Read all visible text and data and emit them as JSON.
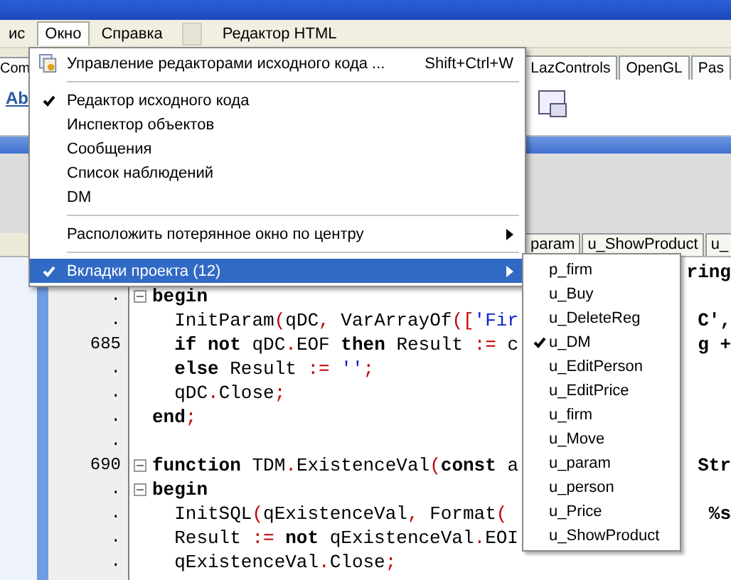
{
  "menubar": [
    {
      "label": "ис",
      "selected": false
    },
    {
      "label": "Окно",
      "selected": true
    },
    {
      "label": "Справка",
      "selected": false
    },
    {
      "kind": "blank",
      "selected": false
    },
    {
      "label": "Редактор HTML",
      "selected": false
    }
  ],
  "palette_tabs": [
    {
      "label": "Com"
    },
    {
      "label": "LazControls"
    },
    {
      "label": "OpenGL"
    },
    {
      "label": "Pas"
    }
  ],
  "toolbar_text": "Ab",
  "editor_tabs": [
    {
      "label": "param"
    },
    {
      "label": "u_ShowProduct"
    },
    {
      "label": "u_"
    }
  ],
  "code": [
    {
      "tail": "ring"
    },
    {
      "num": ".",
      "fold": true,
      "segs": [
        {
          "t": "begin",
          "kind": "kw"
        }
      ]
    },
    {
      "num": ".",
      "fold": false,
      "segs": [
        {
          "t": "  InitParam",
          "kind": "plain"
        },
        {
          "t": "(",
          "kind": "sym"
        },
        {
          "t": "qDC",
          "kind": "plain"
        },
        {
          "t": ",",
          "kind": "sym"
        },
        {
          "t": " VarArrayOf",
          "kind": "plain"
        },
        {
          "t": "([",
          "kind": "sym"
        },
        {
          "t": "'Fir",
          "kind": "str"
        }
      ],
      "tail": "C',"
    },
    {
      "num": "685",
      "fold": false,
      "segs": [
        {
          "t": "  if not",
          "kind": "kw"
        },
        {
          "t": " qDC",
          "kind": "plain"
        },
        {
          "t": ".",
          "kind": "sym"
        },
        {
          "t": "EOF ",
          "kind": "plain"
        },
        {
          "t": "then",
          "kind": "kw"
        },
        {
          "t": " Result ",
          "kind": "plain"
        },
        {
          "t": ":=",
          "kind": "sym"
        },
        {
          "t": " c",
          "kind": "plain"
        }
      ],
      "tail": "g +"
    },
    {
      "num": ".",
      "fold": false,
      "segs": [
        {
          "t": "  else",
          "kind": "kw"
        },
        {
          "t": " Result ",
          "kind": "plain"
        },
        {
          "t": ":=",
          "kind": "sym"
        },
        {
          "t": " ''",
          "kind": "str"
        },
        {
          "t": ";",
          "kind": "sym"
        }
      ]
    },
    {
      "num": ".",
      "fold": false,
      "segs": [
        {
          "t": "  qDC",
          "kind": "plain"
        },
        {
          "t": ".",
          "kind": "sym"
        },
        {
          "t": "Close",
          "kind": "plain"
        },
        {
          "t": ";",
          "kind": "sym"
        }
      ]
    },
    {
      "num": ".",
      "fold": false,
      "segs": [
        {
          "t": "end",
          "kind": "kw"
        },
        {
          "t": ";",
          "kind": "sym"
        }
      ]
    },
    {
      "num": ".",
      "fold": false
    },
    {
      "num": "690",
      "fold": true,
      "segs": [
        {
          "t": "function",
          "kind": "kw"
        },
        {
          "t": " TDM",
          "kind": "plain"
        },
        {
          "t": ".",
          "kind": "sym"
        },
        {
          "t": "ExistenceVal",
          "kind": "plain"
        },
        {
          "t": "(",
          "kind": "sym"
        },
        {
          "t": "const",
          "kind": "kw"
        },
        {
          "t": " a",
          "kind": "plain"
        }
      ],
      "tail": "Str"
    },
    {
      "num": ".",
      "fold": true,
      "segs": [
        {
          "t": "begin",
          "kind": "kw"
        }
      ]
    },
    {
      "num": ".",
      "fold": false,
      "segs": [
        {
          "t": "  InitSQL",
          "kind": "plain"
        },
        {
          "t": "(",
          "kind": "sym"
        },
        {
          "t": "qExistenceVal",
          "kind": "plain"
        },
        {
          "t": ",",
          "kind": "sym"
        },
        {
          "t": " Format",
          "kind": "plain"
        },
        {
          "t": "(",
          "kind": "sym"
        }
      ],
      "tail": "%s"
    },
    {
      "num": ".",
      "fold": false,
      "segs": [
        {
          "t": "  Result ",
          "kind": "plain"
        },
        {
          "t": ":=",
          "kind": "sym"
        },
        {
          "t": " not",
          "kind": "kw"
        },
        {
          "t": " qExistenceVal",
          "kind": "plain"
        },
        {
          "t": ".",
          "kind": "sym"
        },
        {
          "t": "EOI",
          "kind": "plain"
        }
      ]
    },
    {
      "num": ".",
      "fold": false,
      "segs": [
        {
          "t": "  qExistenceVal",
          "kind": "plain"
        },
        {
          "t": ".",
          "kind": "sym"
        },
        {
          "t": "Close",
          "kind": "plain"
        },
        {
          "t": ";",
          "kind": "sym"
        }
      ]
    }
  ],
  "window_menu": [
    {
      "kind": "icon",
      "label": "Управление редакторами исходного кода ...",
      "shortcut": "Shift+Ctrl+W",
      "selected": false
    },
    {
      "kind": "separator"
    },
    {
      "kind": "item",
      "label": "Редактор исходного кода",
      "checked": true,
      "selected": false
    },
    {
      "kind": "item",
      "label": "Инспектор объектов",
      "checked": false,
      "selected": false
    },
    {
      "kind": "item",
      "label": "Сообщения",
      "checked": false,
      "selected": false
    },
    {
      "kind": "item",
      "label": "Список наблюдений",
      "checked": false,
      "selected": false
    },
    {
      "kind": "item",
      "label": "DM",
      "checked": false,
      "selected": false
    },
    {
      "kind": "separator"
    },
    {
      "kind": "submenu",
      "label": "Расположить потерянное окно по центру",
      "checked": false,
      "selected": false
    },
    {
      "kind": "separator"
    },
    {
      "kind": "submenu",
      "label": "Вкладки проекта (12)",
      "checked": true,
      "selected": true
    }
  ],
  "project_tabs": [
    {
      "label": "p_firm",
      "checked": false
    },
    {
      "label": "u_Buy",
      "checked": false
    },
    {
      "label": "u_DeleteReg",
      "checked": false
    },
    {
      "label": "u_DM",
      "checked": true
    },
    {
      "label": "u_EditPerson",
      "checked": false
    },
    {
      "label": "u_EditPrice",
      "checked": false
    },
    {
      "label": "u_firm",
      "checked": false
    },
    {
      "label": "u_Move",
      "checked": false
    },
    {
      "label": "u_param",
      "checked": false
    },
    {
      "label": "u_person",
      "checked": false
    },
    {
      "label": "u_Price",
      "checked": false
    },
    {
      "label": "u_ShowProduct",
      "checked": false
    }
  ]
}
